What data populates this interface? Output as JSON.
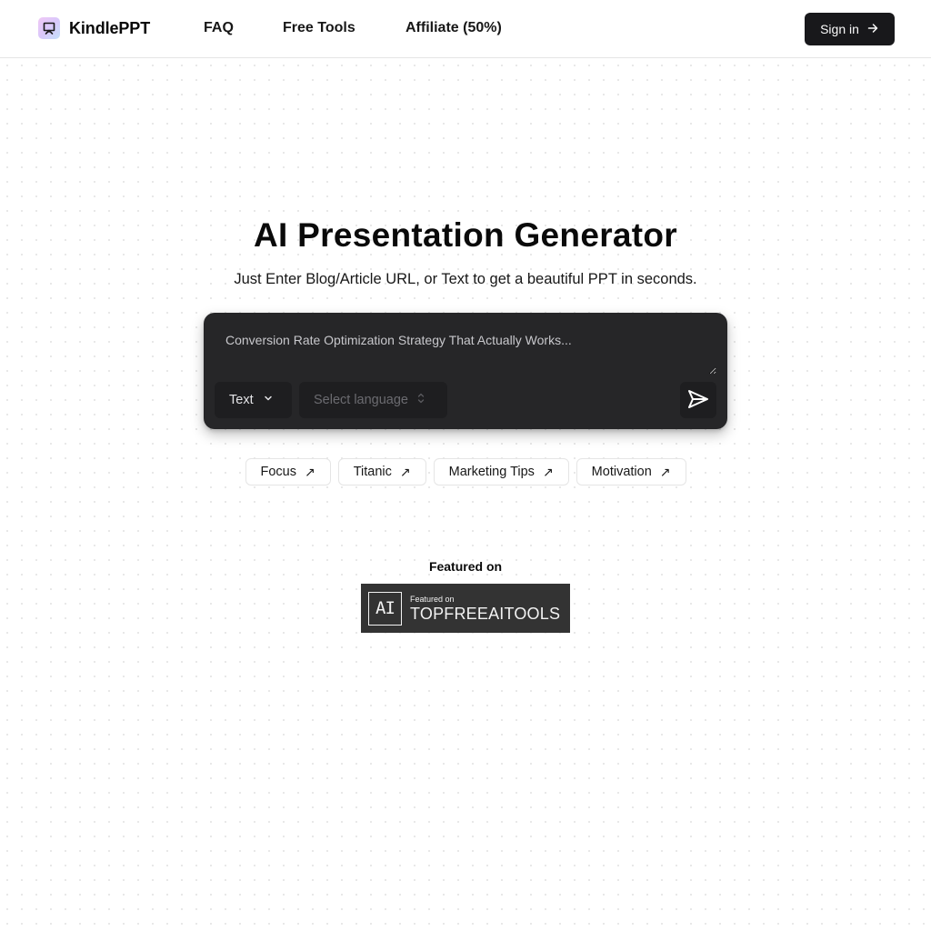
{
  "header": {
    "brand_name": "KindlePPT",
    "brand_icon": "presentation-icon",
    "nav": [
      {
        "label": "FAQ"
      },
      {
        "label": "Free Tools"
      },
      {
        "label": "Affiliate (50%)"
      }
    ],
    "signin_label": "Sign in",
    "signin_icon": "arrow-right-icon"
  },
  "hero": {
    "title": "AI Presentation Generator",
    "subtitle": "Just Enter Blog/Article URL, or Text to get a beautiful PPT in seconds."
  },
  "input_card": {
    "prompt_placeholder": "Conversion Rate Optimization Strategy That Actually Works...",
    "prompt_value": "",
    "type_select": {
      "value": "Text",
      "icon": "chevron-down-icon"
    },
    "language_select": {
      "placeholder": "Select language",
      "icon": "chevrons-up-down-icon"
    },
    "send_icon": "send-icon"
  },
  "suggestions": [
    {
      "label": "Focus",
      "icon": "arrow-up-right-icon"
    },
    {
      "label": "Titanic",
      "icon": "arrow-up-right-icon"
    },
    {
      "label": "Marketing Tips",
      "icon": "arrow-up-right-icon"
    },
    {
      "label": "Motivation",
      "icon": "arrow-up-right-icon"
    }
  ],
  "featured": {
    "label": "Featured on",
    "badge": {
      "logo_text": "AI",
      "small_text": "Featured on",
      "big_text": "TOPFREEAITOOLS"
    }
  },
  "colors": {
    "primary_dark": "#18181b",
    "card_bg": "#262628",
    "control_bg": "#1e1e20",
    "badge_bg": "#333333"
  }
}
